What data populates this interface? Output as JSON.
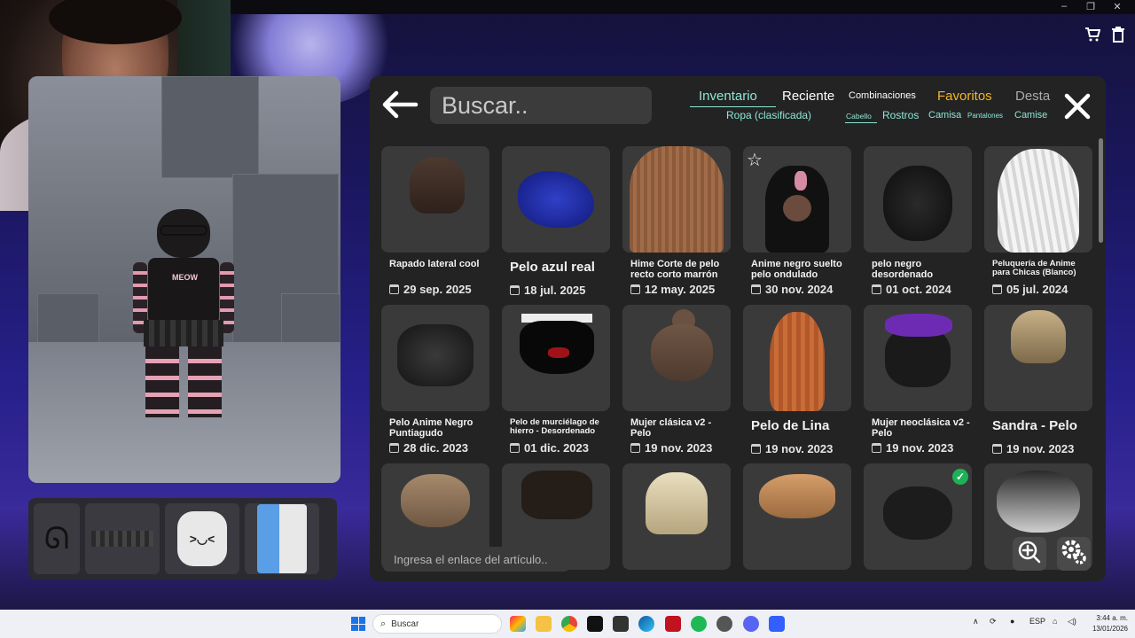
{
  "colors": {
    "accent_teal": "#8ce6d4",
    "favorites_gold": "#f3b624",
    "panel_bg": "#232323",
    "card_bg": "#3a3a3a"
  },
  "search": {
    "placeholder": "Buscar.."
  },
  "tabs": [
    {
      "label": "Inventario",
      "active": true
    },
    {
      "label": "Reciente"
    },
    {
      "label": "Combinaciones"
    },
    {
      "label": "Favoritos"
    },
    {
      "label": "Desta"
    }
  ],
  "subtabs": {
    "category": "Ropa (clasificada)",
    "items": [
      {
        "label": "Cabello",
        "active": true
      },
      {
        "label": "Rostros"
      },
      {
        "label": "Camisa"
      },
      {
        "label": "Pantalones"
      },
      {
        "label": "Camise"
      }
    ]
  },
  "items": [
    {
      "name": "Rapado lateral cool",
      "date": "29 sep. 2025",
      "size": "normal",
      "hair": "brown-short"
    },
    {
      "name": "Pelo azul real",
      "date": "18 jul. 2025",
      "size": "big",
      "hair": "blue-spiky"
    },
    {
      "name": "Hime Corte de pelo recto corto marrón",
      "date": "12 may. 2025",
      "size": "normal",
      "hair": "brown-bob"
    },
    {
      "name": "Anime negro suelto pelo ondulado",
      "date": "30 nov. 2024",
      "size": "normal",
      "hair": "black-cat",
      "favorite": true
    },
    {
      "name": "pelo negro desordenado",
      "date": "01 oct. 2024",
      "size": "normal",
      "hair": "black-messy"
    },
    {
      "name": "Peluquería de Anime para Chicas (Blanco)",
      "date": "05 jul. 2024",
      "size": "tiny",
      "hair": "white-long"
    },
    {
      "name": "Pelo Anime Negro Puntiagudo",
      "date": "28 dic. 2023",
      "size": "normal",
      "hair": "black-spiky"
    },
    {
      "name": "Pelo de murciélago de hierro - Desordenado",
      "date": "01 dic. 2023",
      "size": "tiny",
      "hair": "black-red"
    },
    {
      "name": "Mujer clásica v2 - Pelo",
      "date": "19 nov. 2023",
      "size": "normal",
      "hair": "brown-bun"
    },
    {
      "name": "Pelo de Lina",
      "date": "19 nov. 2023",
      "size": "big",
      "hair": "orange-long"
    },
    {
      "name": "Mujer neoclásica v2 - Pelo",
      "date": "19 nov. 2023",
      "size": "normal",
      "hair": "purple-goggles"
    },
    {
      "name": "Sandra - Pelo",
      "date": "19 nov. 2023",
      "size": "big",
      "hair": "blonde-short"
    },
    {
      "hair": "light-brown"
    },
    {
      "hair": "dark-curly"
    },
    {
      "hair": "blonde-bob"
    },
    {
      "hair": "ginger-swoop"
    },
    {
      "hair": "black-fluffy",
      "equipped": true
    },
    {
      "hair": "black-white-cap"
    }
  ],
  "link_input": {
    "placeholder": "Ingresa el enlace del artículo.."
  },
  "equipped_icons": [
    "bow-hair-icon",
    "skirt-icon",
    "face-icon",
    "arm-icon"
  ],
  "taskbar": {
    "search": "Buscar",
    "lang": "ESP",
    "time": "3:44 a. m.",
    "date": "13/01/2026"
  }
}
